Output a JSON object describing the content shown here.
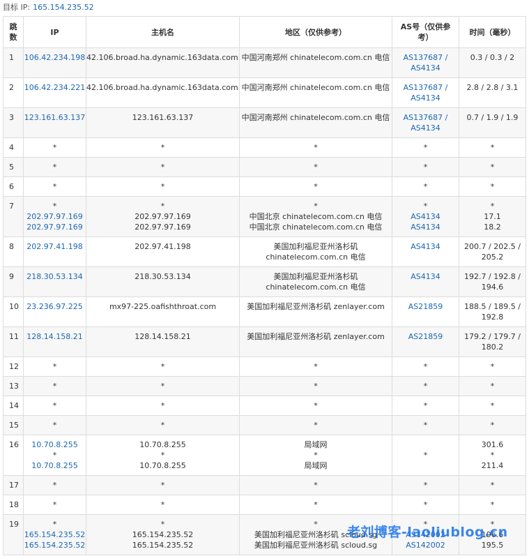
{
  "target": {
    "label": "目标 IP:",
    "ip": "165.154.235.52"
  },
  "headers": {
    "hop": "跳数",
    "ip": "IP",
    "host": "主机名",
    "region": "地区（仅供参考）",
    "asn": "AS号（仅供参考）",
    "time": "时间（毫秒）"
  },
  "rows": [
    {
      "hop": "1",
      "ip": [
        "106.42.234.198"
      ],
      "host": [
        "42.106.broad.ha.dynamic.163data.com.cn"
      ],
      "region": [
        "中国河南郑州 chinatelecom.com.cn 电信"
      ],
      "asn": [
        "AS137687 /",
        "AS4134"
      ],
      "time": [
        "0.3 / 0.3 / 2"
      ]
    },
    {
      "hop": "2",
      "ip": [
        "106.42.234.221"
      ],
      "host": [
        "42.106.broad.ha.dynamic.163data.com.cn"
      ],
      "region": [
        "中国河南郑州 chinatelecom.com.cn 电信"
      ],
      "asn": [
        "AS137687 /",
        "AS4134"
      ],
      "time": [
        "2.8 / 2.8 / 3.1"
      ]
    },
    {
      "hop": "3",
      "ip": [
        "123.161.63.137"
      ],
      "host": [
        "123.161.63.137"
      ],
      "region": [
        "中国河南郑州 chinatelecom.com.cn 电信"
      ],
      "asn": [
        "AS137687 /",
        "AS4134"
      ],
      "time": [
        "0.7 / 1.9 / 1.9"
      ]
    },
    {
      "hop": "4",
      "ip": [
        "*"
      ],
      "host": [
        "*"
      ],
      "region": [
        "*"
      ],
      "asn": [
        "*"
      ],
      "time": [
        "*"
      ]
    },
    {
      "hop": "5",
      "ip": [
        "*"
      ],
      "host": [
        "*"
      ],
      "region": [
        "*"
      ],
      "asn": [
        "*"
      ],
      "time": [
        "*"
      ]
    },
    {
      "hop": "6",
      "ip": [
        "*"
      ],
      "host": [
        "*"
      ],
      "region": [
        "*"
      ],
      "asn": [
        "*"
      ],
      "time": [
        "*"
      ]
    },
    {
      "hop": "7",
      "ip": [
        "*",
        "202.97.97.169",
        "202.97.97.169"
      ],
      "host": [
        "*",
        "202.97.97.169",
        "202.97.97.169"
      ],
      "region": [
        "*",
        "中国北京 chinatelecom.com.cn 电信",
        "中国北京 chinatelecom.com.cn 电信"
      ],
      "asn": [
        "*",
        "AS4134",
        "AS4134"
      ],
      "time": [
        "*",
        "17.1",
        "18.2"
      ]
    },
    {
      "hop": "8",
      "ip": [
        "202.97.41.198"
      ],
      "host": [
        "202.97.41.198"
      ],
      "region": [
        "美国加利福尼亚州洛杉矶",
        "chinatelecom.com.cn 电信"
      ],
      "asn": [
        "AS4134"
      ],
      "time": [
        "200.7 / 202.5 /",
        "205.2"
      ]
    },
    {
      "hop": "9",
      "ip": [
        "218.30.53.134"
      ],
      "host": [
        "218.30.53.134"
      ],
      "region": [
        "美国加利福尼亚州洛杉矶",
        "chinatelecom.com.cn 电信"
      ],
      "asn": [
        "AS4134"
      ],
      "time": [
        "192.7 / 192.8 /",
        "194.6"
      ]
    },
    {
      "hop": "10",
      "ip": [
        "23.236.97.225"
      ],
      "host": [
        "mx97-225.oafishthroat.com"
      ],
      "region": [
        "美国加利福尼亚州洛杉矶 zenlayer.com"
      ],
      "asn": [
        "AS21859"
      ],
      "time": [
        "188.5 / 189.5 /",
        "192.8"
      ]
    },
    {
      "hop": "11",
      "ip": [
        "128.14.158.21"
      ],
      "host": [
        "128.14.158.21"
      ],
      "region": [
        "美国加利福尼亚州洛杉矶 zenlayer.com"
      ],
      "asn": [
        "AS21859"
      ],
      "time": [
        "179.2 / 179.7 /",
        "180.2"
      ]
    },
    {
      "hop": "12",
      "ip": [
        "*"
      ],
      "host": [
        "*"
      ],
      "region": [
        "*"
      ],
      "asn": [
        "*"
      ],
      "time": [
        "*"
      ]
    },
    {
      "hop": "13",
      "ip": [
        "*"
      ],
      "host": [
        "*"
      ],
      "region": [
        "*"
      ],
      "asn": [
        "*"
      ],
      "time": [
        "*"
      ]
    },
    {
      "hop": "14",
      "ip": [
        "*"
      ],
      "host": [
        "*"
      ],
      "region": [
        "*"
      ],
      "asn": [
        "*"
      ],
      "time": [
        "*"
      ]
    },
    {
      "hop": "15",
      "ip": [
        "*"
      ],
      "host": [
        "*"
      ],
      "region": [
        "*"
      ],
      "asn": [
        "*"
      ],
      "time": [
        "*"
      ]
    },
    {
      "hop": "16",
      "ip": [
        "10.70.8.255",
        "*",
        "10.70.8.255"
      ],
      "host": [
        "10.70.8.255",
        "*",
        "10.70.8.255"
      ],
      "region": [
        "局域网",
        "*",
        "局域网"
      ],
      "asn": [
        "",
        "*",
        ""
      ],
      "time": [
        "301.6",
        "*",
        "211.4"
      ]
    },
    {
      "hop": "17",
      "ip": [
        "*"
      ],
      "host": [
        "*"
      ],
      "region": [
        "*"
      ],
      "asn": [
        "*"
      ],
      "time": [
        "*"
      ]
    },
    {
      "hop": "18",
      "ip": [
        "*"
      ],
      "host": [
        "*"
      ],
      "region": [
        "*"
      ],
      "asn": [
        "*"
      ],
      "time": [
        "*"
      ]
    },
    {
      "hop": "19",
      "ip": [
        "*",
        "165.154.235.52",
        "165.154.235.52"
      ],
      "host": [
        "*",
        "165.154.235.52",
        "165.154.235.52"
      ],
      "region": [
        "*",
        "美国加利福尼亚州洛杉矶 scloud.sg",
        "美国加利福尼亚州洛杉矶 scloud.sg"
      ],
      "asn": [
        "*",
        "AS142002",
        "AS142002"
      ],
      "time": [
        "*",
        "196.6",
        "195.5"
      ]
    }
  ],
  "watermark": "老刘博客-laoliublog.cn"
}
